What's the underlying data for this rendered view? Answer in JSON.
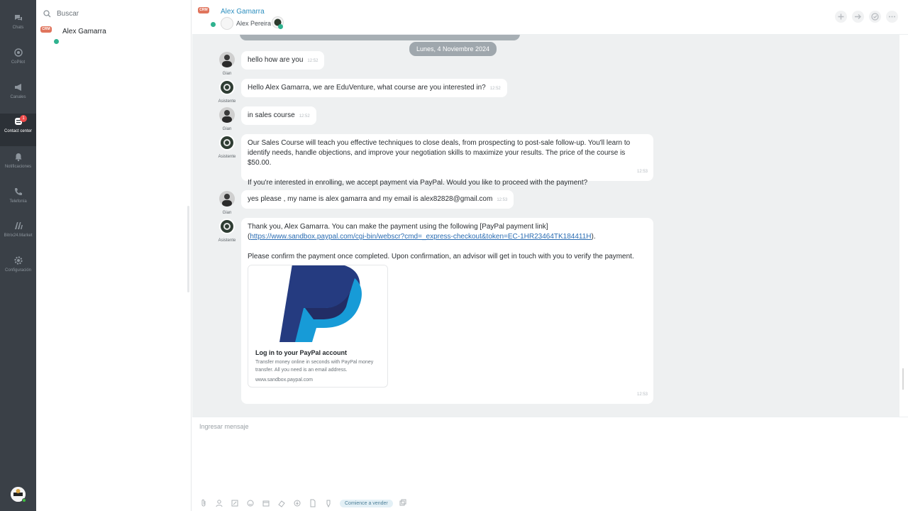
{
  "sidebar": {
    "items": [
      {
        "label": "Chats",
        "icon": "chats-icon"
      },
      {
        "label": "CoPilot",
        "icon": "copilot-icon"
      },
      {
        "label": "Canales",
        "icon": "megaphone-icon"
      },
      {
        "label": "Contact center",
        "icon": "contact-center-icon",
        "badge": "1",
        "active": true
      },
      {
        "label": "Notificaciones",
        "icon": "bell-icon"
      },
      {
        "label": "Telefonía",
        "icon": "phone-icon"
      },
      {
        "label": "Bitrix24.Market",
        "icon": "market-icon"
      },
      {
        "label": "Configuración",
        "icon": "gear-icon"
      }
    ]
  },
  "chat_list": {
    "search_placeholder": "Buscar",
    "items": [
      {
        "crm_badge": "CRM",
        "name": "Alex Gamarra"
      }
    ]
  },
  "header": {
    "crm_badge": "CRM",
    "title": "Alex Gamarra",
    "subtitle": "Alex Pereira"
  },
  "conversation": {
    "date_chip": "Lunes, 4 Noviembre 2024",
    "messages": [
      {
        "author": "Gian",
        "text": "hello how are you",
        "time": "12:52"
      },
      {
        "author": "Asistente",
        "text": "Hello Alex Gamarra, we are EduVenture, what course are you interested in?",
        "time": "12:52"
      },
      {
        "author": "Gian",
        "text": "in sales course",
        "time": "12:52"
      },
      {
        "author": "Asistente",
        "line1": "Our Sales Course will teach you effective techniques to close deals, from prospecting to post-sale follow-up. You'll learn to",
        "line2": "identify needs, handle objections, and improve your negotiation skills to maximize your results. The price of the course is $50.00.",
        "line3": "If you're interested in enrolling, we accept payment via PayPal. Would you like to proceed with the payment?",
        "time": "12:53"
      },
      {
        "author": "Gian",
        "text": "yes please , my name is alex gamarra and my email is alex82828@gmail.com",
        "time": "12:53"
      },
      {
        "author": "Asistente",
        "line1": "Thank you, Alex Gamarra. You can make the payment using the following [PayPal payment link]",
        "link": "https://www.sandbox.paypal.com/cgi-bin/webscr?cmd=_express-checkout&token=EC-1HR23464TK184411H",
        "line3": "Please confirm the payment once completed. Upon confirmation, an advisor will get in touch with you to verify the payment.",
        "time": "12:53"
      }
    ],
    "link_preview": {
      "title": "Log in to your PayPal account",
      "description": "Transfer money online in seconds with PayPal money transfer. All you need is an email address.",
      "url": "www.sandbox.paypal.com"
    }
  },
  "composer": {
    "placeholder": "Ingresar mensaje",
    "sell_button": "Comience a vender"
  },
  "colors": {
    "rail": "#3a4047",
    "chat_bg": "#eef0f1",
    "accent": "#2d8fbf",
    "crm_badge": "#e0745c",
    "whatsapp": "#2fb28f",
    "paypal_dark": "#253b80",
    "paypal_light": "#179bd7"
  }
}
